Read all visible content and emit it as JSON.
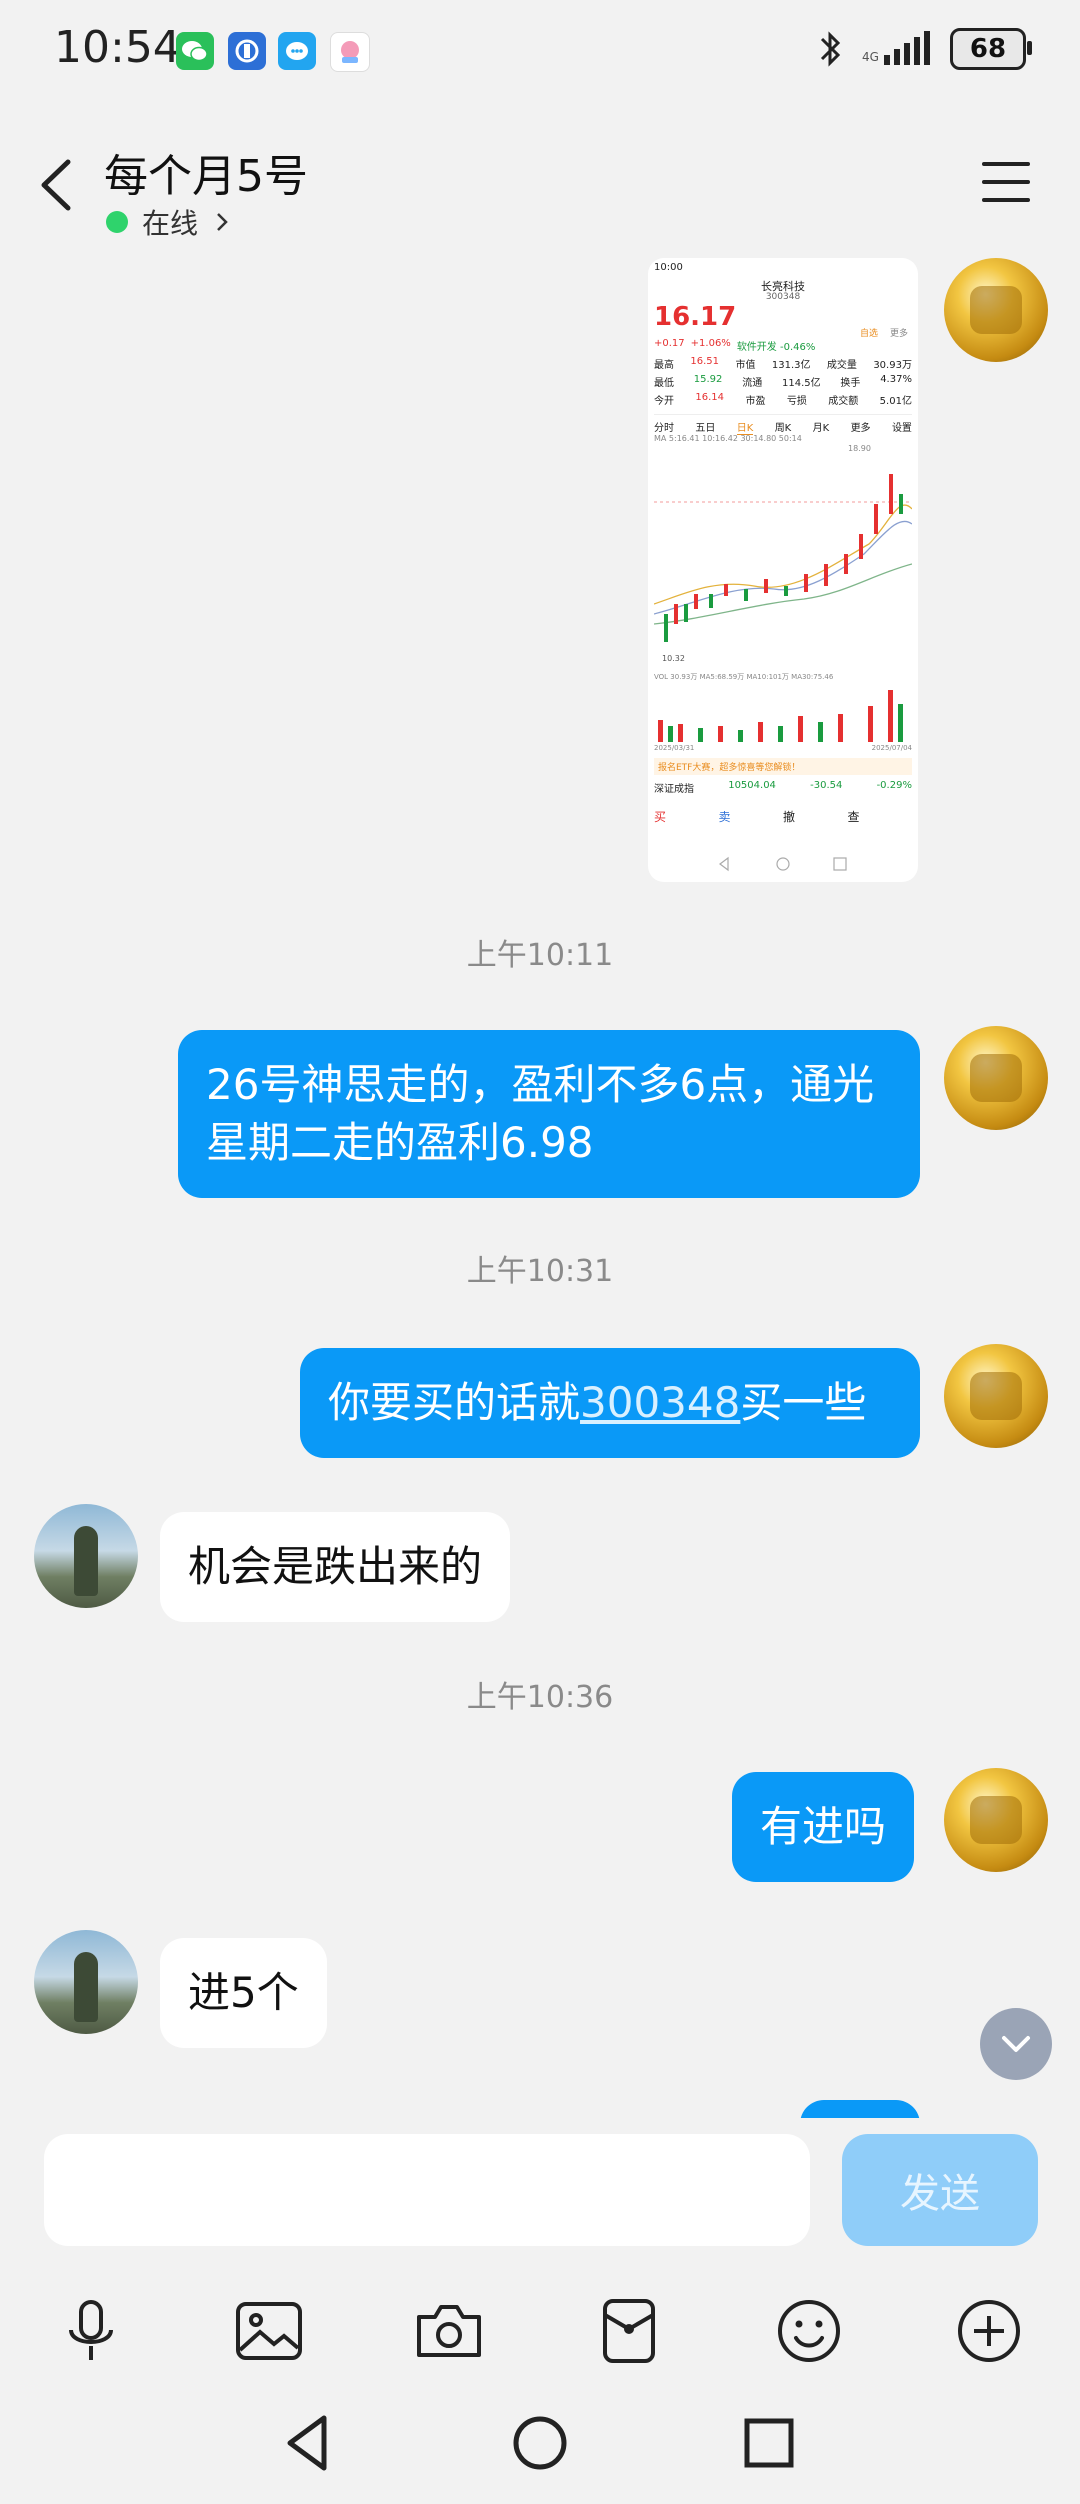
{
  "status": {
    "time": "10:54",
    "battery": "68",
    "app_icons": [
      "wechat-icon",
      "blue-app-icon",
      "qq-icon",
      "photo-app-icon"
    ]
  },
  "header": {
    "title": "每个月5号",
    "online": "在线"
  },
  "stock_shot": {
    "time": "10:00",
    "name": "长亮科技",
    "code": "300348",
    "price": "16.17",
    "change": "+0.17",
    "change_pct": "+1.06%",
    "sector": "软件开发 -0.46%",
    "follow": "自选",
    "more": "更多",
    "high_label": "最高",
    "high": "16.51",
    "low_label": "最低",
    "low": "15.92",
    "open_label": "今开",
    "open": "16.14",
    "mcap_label": "市值",
    "mcap": "131.3亿",
    "float_label": "流通",
    "float": "114.5亿",
    "pe_label": "市盈",
    "pe": "亏损",
    "vol_label": "成交量",
    "vol": "30.93万",
    "turn_label": "换手",
    "turn": "4.37%",
    "amount_label": "成交额",
    "amount": "5.01亿",
    "tabs": [
      "分时",
      "五日",
      "日K",
      "周K",
      "月K",
      "更多",
      "设置"
    ],
    "ma_line": "MA 5:16.41 10:16.42 30:14.80 50:14",
    "peak": "18.90",
    "low_mark": "10.32",
    "vol_line": "VOL 30.93万 MA5:68.59万 MA10:101万 MA30:75.46",
    "date_start": "2025/03/31",
    "date_end": "2025/07/04",
    "banner": "报名ETF大赛，超多惊喜等您解锁！",
    "index_name": "深证成指",
    "index_value": "10504.04",
    "index_change": "-30.54",
    "index_pct": "-0.29%",
    "buy": "买",
    "sell": "卖",
    "cancel": "撤",
    "query": "查"
  },
  "messages": [
    {
      "time": "上午10:11"
    },
    {
      "text": "26号神思走的，盈利不多6点，通光星期二走的盈利6.98"
    },
    {
      "time": "上午10:31"
    },
    {
      "text_before": "你要买的话就",
      "link": "300348",
      "text_after": "买一些"
    },
    {
      "text": "机会是跌出来的"
    },
    {
      "time": "上午10:36"
    },
    {
      "text": "有进吗"
    },
    {
      "text": "进5个"
    }
  ],
  "composer": {
    "input_value": "",
    "send_label": "发送"
  }
}
